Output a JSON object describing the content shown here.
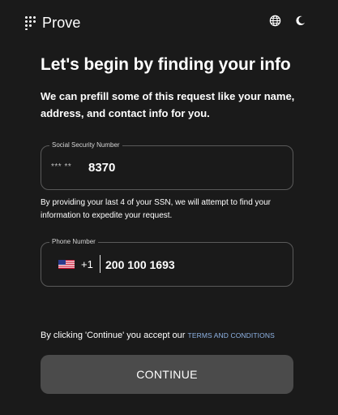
{
  "header": {
    "brand": "Prove",
    "icons": {
      "logo": "dot-grid-logo-icon",
      "language": "globe-icon",
      "theme": "moon-icon"
    }
  },
  "main": {
    "title": "Let's begin by finding your info",
    "intro": "We can prefill some of this request like your name, address, and contact info for you."
  },
  "ssn_field": {
    "label": "Social Security Number",
    "mask": "*** **",
    "value": "8370"
  },
  "ssn_note": "By providing your last 4 of your SSN, we will attempt to find your information to expedite your request.",
  "phone_field": {
    "label": "Phone Number",
    "country_flag": "us-flag-icon",
    "country_code": "+1",
    "value": "200 100 1693"
  },
  "consent": {
    "text": "By clicking 'Continue' you accept our",
    "link": "TERMS AND CONDITIONS"
  },
  "continue_button": {
    "label": "CONTINUE"
  },
  "colors": {
    "background": "#1a1a1a",
    "field_border": "#5a5a5a",
    "button_bg": "#4b4b4b",
    "link": "#8fb4e6",
    "text": "#ffffff"
  }
}
